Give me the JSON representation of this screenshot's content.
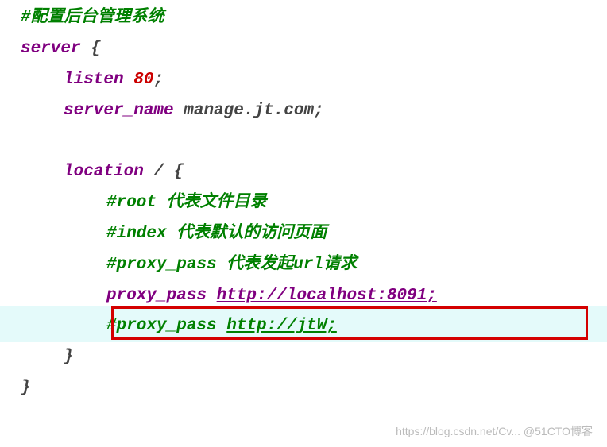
{
  "line1_comment": "#配置后台管理系统",
  "line2_kw": "server",
  "line2_brace": " {",
  "line3_kw": "listen ",
  "line3_num": "80",
  "line3_end": ";",
  "line4_kw": "server_name ",
  "line4_val": "manage.jt.com;",
  "line6_kw": "location ",
  "line6_path": "/ {",
  "line7_comment": "#root 代表文件目录",
  "line8_comment": "#index 代表默认的访问页面",
  "line9_comment": "#proxy_pass 代表发起url请求",
  "line10_kw": "proxy_pass ",
  "line10_url": "http://localhost:8091;",
  "line11_kw": "#proxy_pass ",
  "line11_url": "http://jtW;",
  "line12_brace": "}",
  "line13_brace": "}",
  "watermark": "https://blog.csdn.net/Cv... @51CTO博客"
}
